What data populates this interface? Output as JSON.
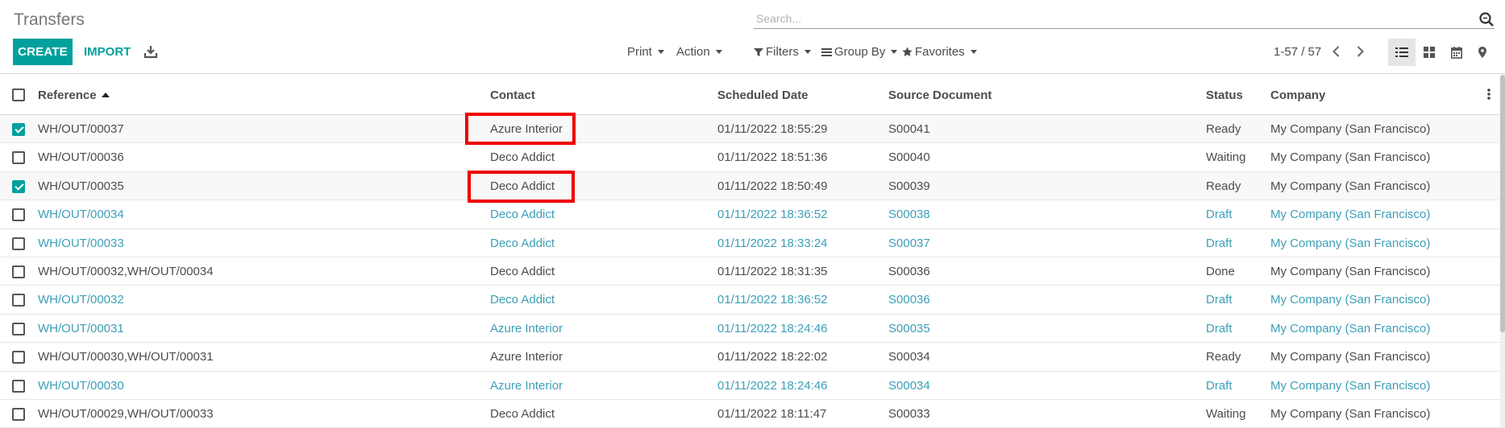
{
  "page": {
    "title": "Transfers"
  },
  "search": {
    "placeholder": "Search..."
  },
  "toolbar": {
    "create_label": "CREATE",
    "import_label": "IMPORT",
    "print_label": "Print",
    "action_label": "Action",
    "filters_label": "Filters",
    "group_by_label": "Group By",
    "favorites_label": "Favorites"
  },
  "pager": {
    "value": "1-57 / 57"
  },
  "colors": {
    "accent": "#00a09d",
    "link": "#3c9fb7",
    "highlight": "#ee0000"
  },
  "icons": [
    "search-icon",
    "download-icon",
    "filter-icon",
    "group-by-icon",
    "star-icon",
    "chevron-left-icon",
    "chevron-right-icon",
    "list-view-icon",
    "kanban-view-icon",
    "calendar-view-icon",
    "map-view-icon",
    "kebab-icon"
  ],
  "table": {
    "headers": {
      "reference": "Reference",
      "contact": "Contact",
      "scheduled_date": "Scheduled Date",
      "source_document": "Source Document",
      "status": "Status",
      "company": "Company"
    },
    "sort": {
      "column": "reference",
      "direction": "ascending"
    },
    "rows": [
      {
        "reference": "WH/OUT/00037",
        "contact": "Azure Interior",
        "scheduled_date": "01/11/2022 18:55:29",
        "source_document": "S00041",
        "status": "Ready",
        "company": "My Company (San Francisco)",
        "selected": true,
        "style": "default",
        "highlighted": "contact"
      },
      {
        "reference": "WH/OUT/00036",
        "contact": "Deco Addict",
        "scheduled_date": "01/11/2022 18:51:36",
        "source_document": "S00040",
        "status": "Waiting",
        "company": "My Company (San Francisco)",
        "selected": false,
        "style": "default"
      },
      {
        "reference": "WH/OUT/00035",
        "contact": "Deco Addict",
        "scheduled_date": "01/11/2022 18:50:49",
        "source_document": "S00039",
        "status": "Ready",
        "company": "My Company (San Francisco)",
        "selected": true,
        "style": "default",
        "highlighted": "contact"
      },
      {
        "reference": "WH/OUT/00034",
        "contact": "Deco Addict",
        "scheduled_date": "01/11/2022 18:36:52",
        "source_document": "S00038",
        "status": "Draft",
        "company": "My Company (San Francisco)",
        "selected": false,
        "style": "draft"
      },
      {
        "reference": "WH/OUT/00033",
        "contact": "Deco Addict",
        "scheduled_date": "01/11/2022 18:33:24",
        "source_document": "S00037",
        "status": "Draft",
        "company": "My Company (San Francisco)",
        "selected": false,
        "style": "draft"
      },
      {
        "reference": "WH/OUT/00032,WH/OUT/00034",
        "contact": "Deco Addict",
        "scheduled_date": "01/11/2022 18:31:35",
        "source_document": "S00036",
        "status": "Done",
        "company": "My Company (San Francisco)",
        "selected": false,
        "style": "default"
      },
      {
        "reference": "WH/OUT/00032",
        "contact": "Deco Addict",
        "scheduled_date": "01/11/2022 18:36:52",
        "source_document": "S00036",
        "status": "Draft",
        "company": "My Company (San Francisco)",
        "selected": false,
        "style": "draft"
      },
      {
        "reference": "WH/OUT/00031",
        "contact": "Azure Interior",
        "scheduled_date": "01/11/2022 18:24:46",
        "source_document": "S00035",
        "status": "Draft",
        "company": "My Company (San Francisco)",
        "selected": false,
        "style": "draft"
      },
      {
        "reference": "WH/OUT/00030,WH/OUT/00031",
        "contact": "Azure Interior",
        "scheduled_date": "01/11/2022 18:22:02",
        "source_document": "S00034",
        "status": "Ready",
        "company": "My Company (San Francisco)",
        "selected": false,
        "style": "default"
      },
      {
        "reference": "WH/OUT/00030",
        "contact": "Azure Interior",
        "scheduled_date": "01/11/2022 18:24:46",
        "source_document": "S00034",
        "status": "Draft",
        "company": "My Company (San Francisco)",
        "selected": false,
        "style": "draft"
      },
      {
        "reference": "WH/OUT/00029,WH/OUT/00033",
        "contact": "Deco Addict",
        "scheduled_date": "01/11/2022 18:11:47",
        "source_document": "S00033",
        "status": "Waiting",
        "company": "My Company (San Francisco)",
        "selected": false,
        "style": "default"
      }
    ]
  }
}
